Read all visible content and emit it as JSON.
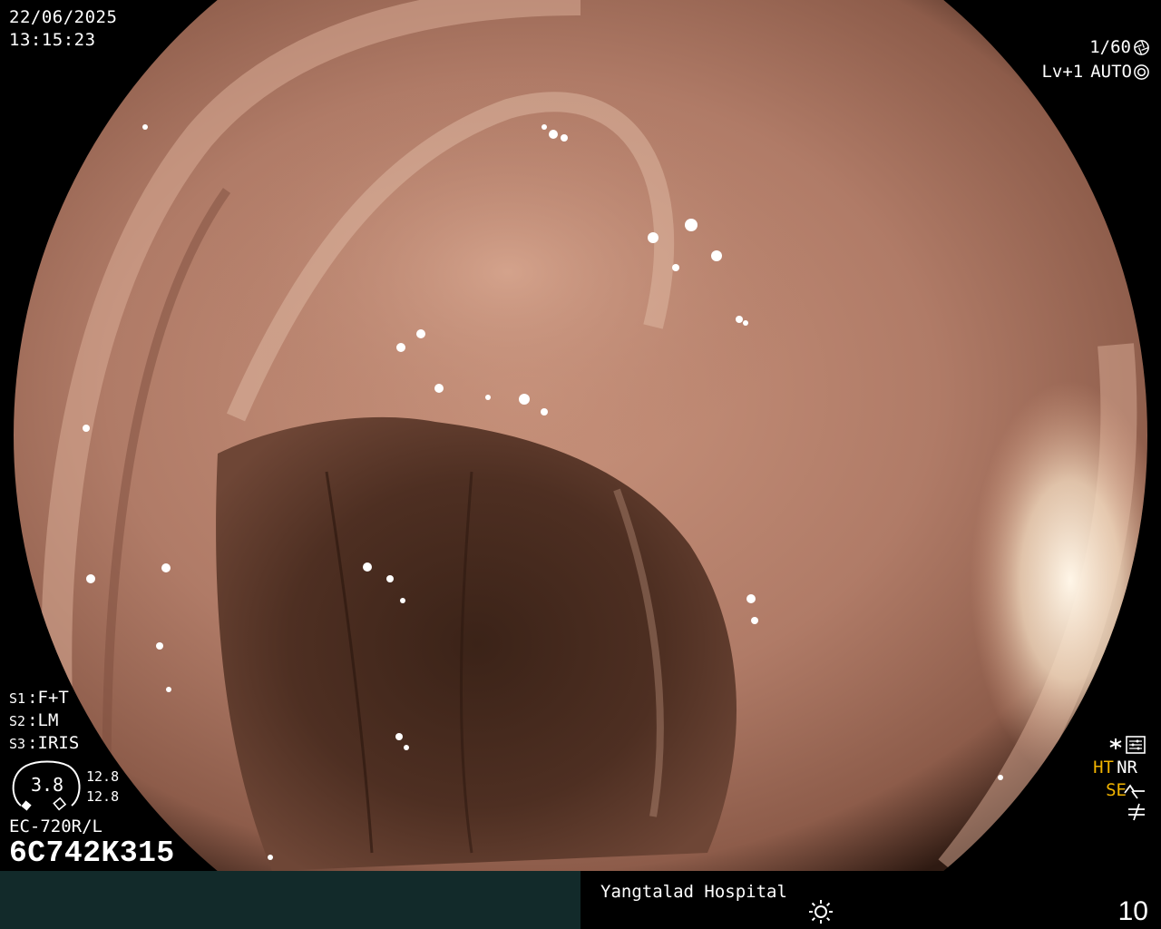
{
  "osd": {
    "date": "22/06/2025",
    "time": "13:15:23",
    "shutter": "1/60",
    "enhance_level": "Lv+1",
    "iris_mode": "AUTO",
    "settings": [
      {
        "key": "S1",
        "value": "F+T"
      },
      {
        "key": "S2",
        "value": "LM"
      },
      {
        "key": "S3",
        "value": "IRIS"
      }
    ],
    "tube_value": "3.8",
    "length_a": "12.8",
    "length_b": "12.8",
    "scope_model": "EC-720R/L",
    "scope_serial": "6C742K315",
    "right_flags": {
      "ht": "HT",
      "nr": "NR",
      "se": "SE"
    }
  },
  "status_bar": {
    "hospital": "Yangtalad Hospital",
    "image_count": "10",
    "colors": {
      "left_panel": "#122a2a",
      "right_panel": "#000000",
      "flag_color": "#f2b400"
    }
  },
  "icons": {
    "shutter_icon": "aperture-icon",
    "iris_icon": "iris-icon",
    "menu_icon": "settings-panel-icon",
    "star_icon": "asterisk-icon",
    "se_icon": "structure-enhance-icon",
    "noise_icon": "not-equal-icon",
    "sun_icon": "sun-icon"
  },
  "image": {
    "subject": "endoscopic colonoscopy view of bowel lumen",
    "tones": [
      "#b88270",
      "#8a5a4a",
      "#3c2419",
      "#f4e6d0"
    ]
  }
}
